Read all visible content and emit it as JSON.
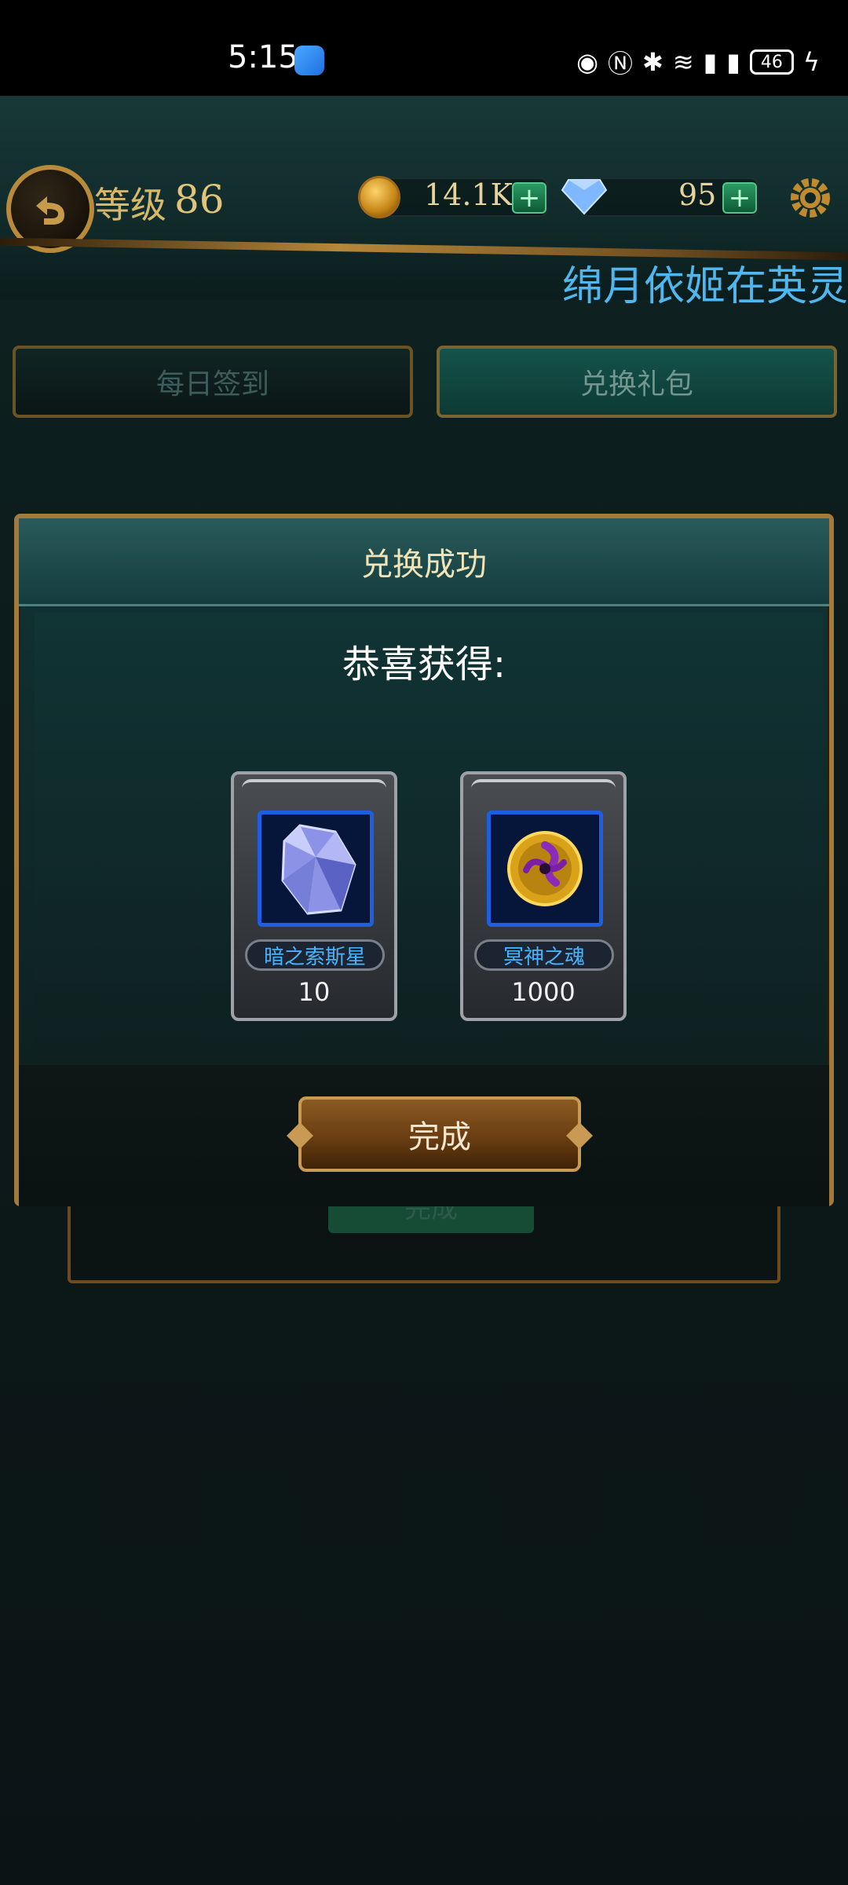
{
  "status_bar": {
    "time": "5:15",
    "battery": "46",
    "icons": [
      "eye-icon",
      "nfc-icon",
      "bluetooth-icon",
      "wifi-icon",
      "signal-icon",
      "signal-5g-icon",
      "charging-icon"
    ]
  },
  "header": {
    "level_label": "等级",
    "level_value": "86",
    "gold": "14.1K",
    "diamonds": "95",
    "ticker": "绵月依姬在英灵"
  },
  "tabs": [
    {
      "label": "每日签到",
      "active": false
    },
    {
      "label": "兑换礼包",
      "active": true
    }
  ],
  "background_panel": {
    "button_label": "完成"
  },
  "modal": {
    "title": "兑换成功",
    "congrats": "恭喜获得:",
    "rewards": [
      {
        "name": "暗之索斯星",
        "count": "10",
        "icon": "crystal-icon"
      },
      {
        "name": "冥神之魂",
        "count": "1000",
        "icon": "soul-orb-icon"
      }
    ],
    "done_label": "完成"
  },
  "colors": {
    "accent_gold": "#c89a54",
    "item_name_blue": "#46b4ff",
    "ticker_blue": "#4fb6ee"
  }
}
